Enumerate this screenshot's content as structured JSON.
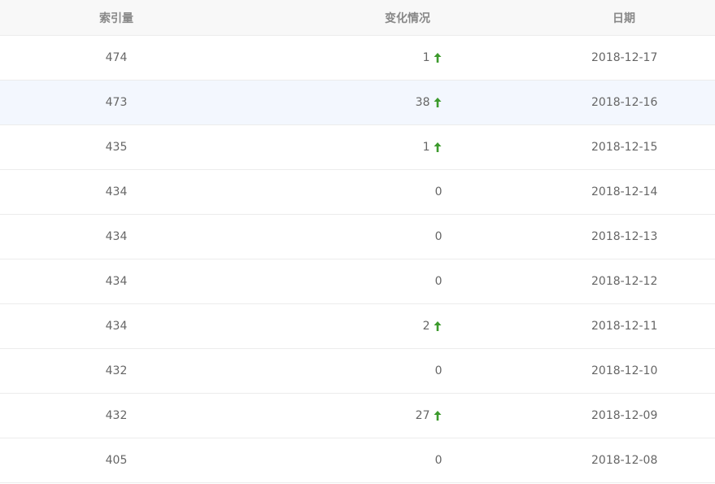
{
  "columns": {
    "index": "索引量",
    "change": "变化情况",
    "date": "日期"
  },
  "colors": {
    "up_arrow": "#3c9a2c",
    "header_bg": "#f8f8f8",
    "highlight_row_bg": "#f3f7fe"
  },
  "rows": [
    {
      "index": "474",
      "change": "1",
      "trend": "up",
      "date": "2018-12-17"
    },
    {
      "index": "473",
      "change": "38",
      "trend": "up",
      "date": "2018-12-16"
    },
    {
      "index": "435",
      "change": "1",
      "trend": "up",
      "date": "2018-12-15"
    },
    {
      "index": "434",
      "change": "0",
      "trend": "none",
      "date": "2018-12-14"
    },
    {
      "index": "434",
      "change": "0",
      "trend": "none",
      "date": "2018-12-13"
    },
    {
      "index": "434",
      "change": "0",
      "trend": "none",
      "date": "2018-12-12"
    },
    {
      "index": "434",
      "change": "2",
      "trend": "up",
      "date": "2018-12-11"
    },
    {
      "index": "432",
      "change": "0",
      "trend": "none",
      "date": "2018-12-10"
    },
    {
      "index": "432",
      "change": "27",
      "trend": "up",
      "date": "2018-12-09"
    },
    {
      "index": "405",
      "change": "0",
      "trend": "none",
      "date": "2018-12-08"
    }
  ]
}
